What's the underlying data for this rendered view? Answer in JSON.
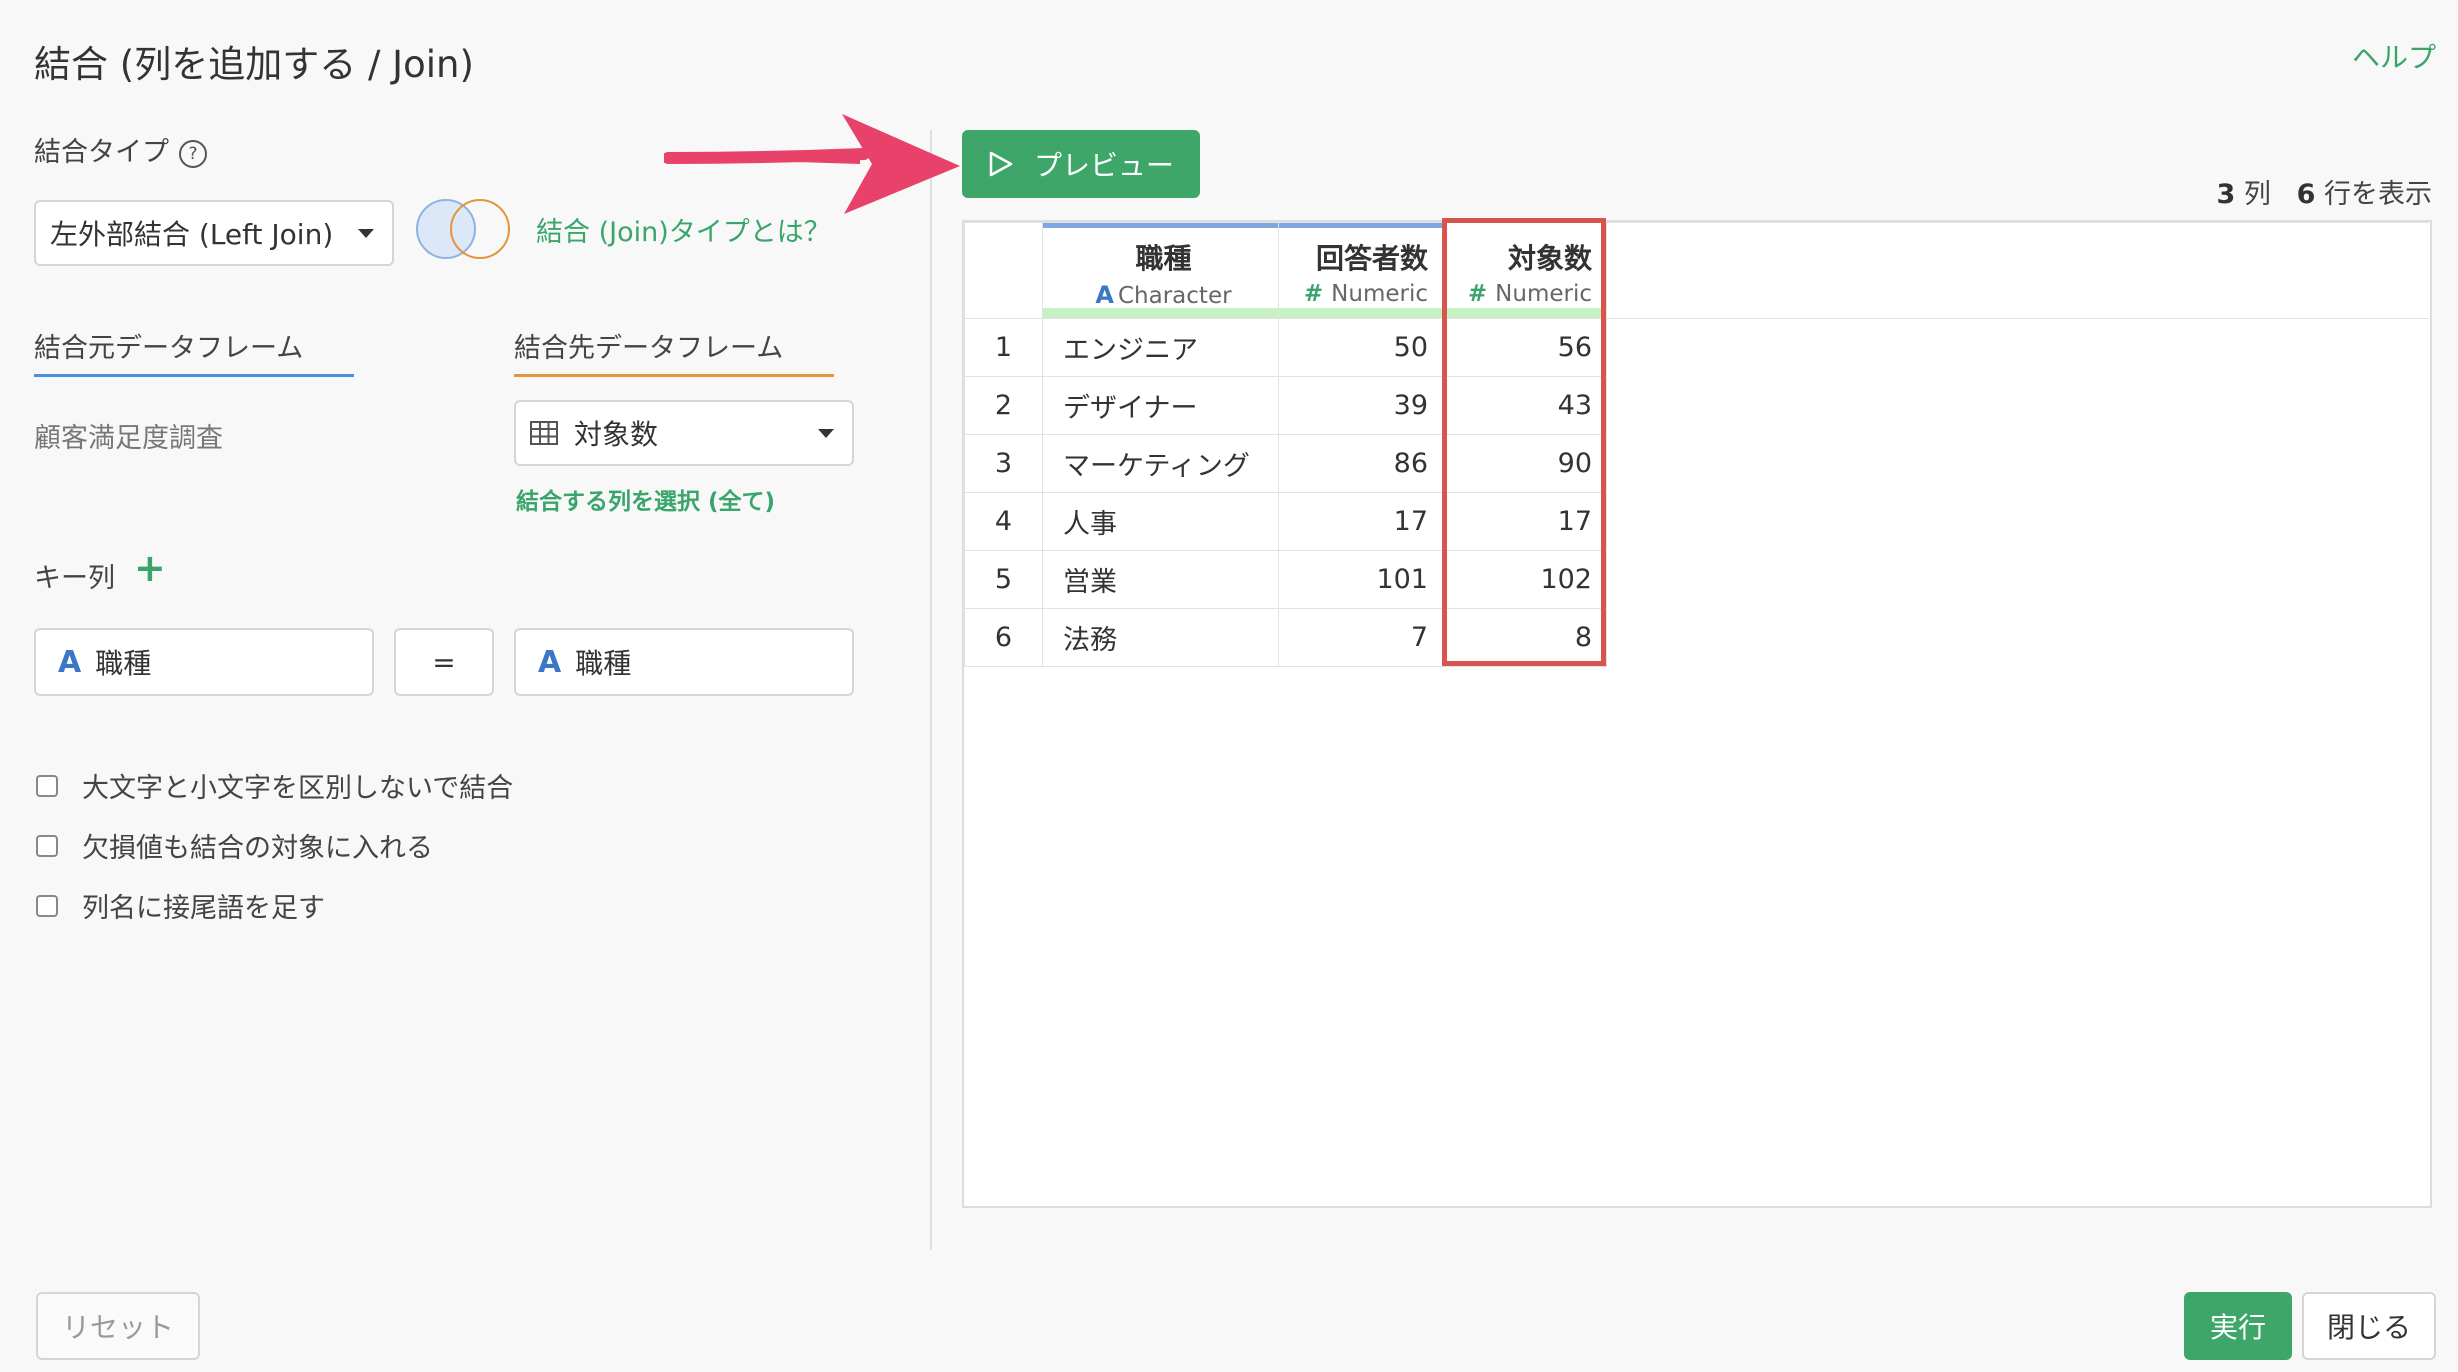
{
  "dialog": {
    "title": "結合 (列を追加する / Join)",
    "help_link": "ヘルプ"
  },
  "left": {
    "join_type_label": "結合タイプ",
    "join_type_help": "?",
    "join_type_value": "左外部結合 (Left Join)",
    "join_type_link": "結合 (Join)タイプとは？",
    "source_tab": "結合元データフレーム",
    "target_tab": "結合先データフレーム",
    "source_name": "顧客満足度調査",
    "target_value": "対象数",
    "select_columns_link": "結合する列を選択 (全て)",
    "key_label": "キー列",
    "key_add": "+",
    "key_left": "職種",
    "key_eq": "=",
    "key_right": "職種",
    "char_icon": "A",
    "options": [
      "大文字と小文字を区別しないで結合",
      "欠損値も結合の対象に入れる",
      "列名に接尾語を足す"
    ],
    "colors": {
      "source_tab": "#4a90e2",
      "target_tab": "#e2953a",
      "accent": "#3fa66a"
    }
  },
  "preview": {
    "button_label": "プレビュー",
    "summary_cols": "3",
    "summary_cols_unit": "列",
    "summary_rows": "6",
    "summary_rows_unit": "行を表示",
    "columns": [
      {
        "name": "職種",
        "type_icon": "A",
        "type": "Character"
      },
      {
        "name": "回答者数",
        "type_icon": "#",
        "type": "Numeric"
      },
      {
        "name": "対象数",
        "type_icon": "#",
        "type": "Numeric"
      }
    ],
    "rows": [
      {
        "n": "1",
        "job": "エンジニア",
        "resp": "50",
        "target": "56"
      },
      {
        "n": "2",
        "job": "デザイナー",
        "resp": "39",
        "target": "43"
      },
      {
        "n": "3",
        "job": "マーケティング",
        "resp": "86",
        "target": "90"
      },
      {
        "n": "4",
        "job": "人事",
        "resp": "17",
        "target": "17"
      },
      {
        "n": "5",
        "job": "営業",
        "resp": "101",
        "target": "102"
      },
      {
        "n": "6",
        "job": "法務",
        "resp": "7",
        "target": "8"
      }
    ]
  },
  "footer": {
    "reset": "リセット",
    "run": "実行",
    "close": "閉じる"
  }
}
